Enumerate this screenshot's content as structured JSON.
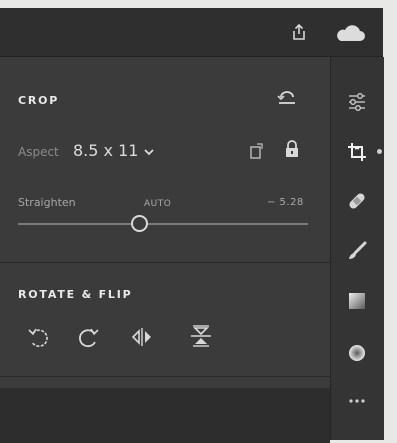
{
  "crop": {
    "title": "CROP",
    "aspect_label": "Aspect",
    "aspect_value": "8.5 x 11",
    "straighten_label": "Straighten",
    "auto_label": "AUTO",
    "straighten_value": "− 5.28",
    "straighten_level": 0.42
  },
  "rotate": {
    "title": "ROTATE & FLIP"
  },
  "icons": {
    "share": "share-icon",
    "cloud": "cloud-icon",
    "reset": "reset-icon",
    "rotate_ccw": "rotate-ccw-icon",
    "rotate_cw": "rotate-cw-icon",
    "flip_h": "flip-horizontal-icon",
    "flip_v": "flip-vertical-icon",
    "rail": [
      "sliders-icon",
      "crop-icon",
      "healing-icon",
      "brush-icon",
      "gradient-icon",
      "radial-icon",
      "more-icon"
    ]
  },
  "colors": {
    "panel": "#3b3b3b",
    "rail": "#343434",
    "text": "#dcdcdc"
  }
}
